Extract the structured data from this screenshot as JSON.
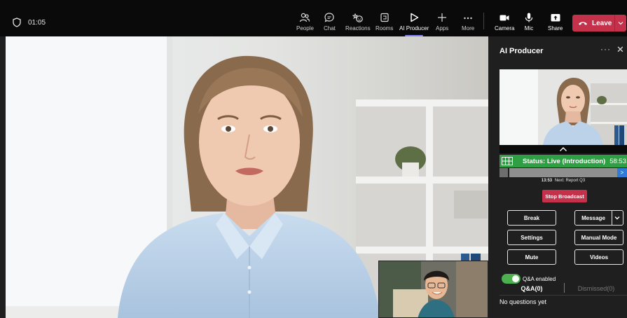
{
  "meeting": {
    "elapsed": "01:05"
  },
  "toolbar": {
    "people": "People",
    "chat": "Chat",
    "reactions": "Reactions",
    "rooms": "Rooms",
    "ai_producer": "AI Producer",
    "apps": "Apps",
    "more": "More",
    "camera": "Camera",
    "mic": "Mic",
    "share": "Share",
    "leave": "Leave"
  },
  "panel": {
    "title": "AI Producer",
    "status_text": "Status: Live (Introduction)",
    "status_duration": "58:53",
    "progress_fraction": 0.07,
    "next_time": "13:53",
    "next_label": "Next: Report Q3",
    "stop_broadcast": "Stop Broadcast",
    "buttons": {
      "break": "Break",
      "message": "Message",
      "settings": "Settings",
      "manual_mode": "Manual Mode",
      "mute": "Mute",
      "videos": "Videos"
    },
    "qa_toggle_label": "Q&A enabled",
    "qa_tab": "Q&A(0)",
    "dismissed_tab": "Dismissed(0)",
    "empty_text": "No questions yet"
  },
  "colors": {
    "accent": "#7f85f5",
    "live_status": "#2ea043",
    "danger": "#c4314b",
    "toggle_on": "#4caf50"
  }
}
